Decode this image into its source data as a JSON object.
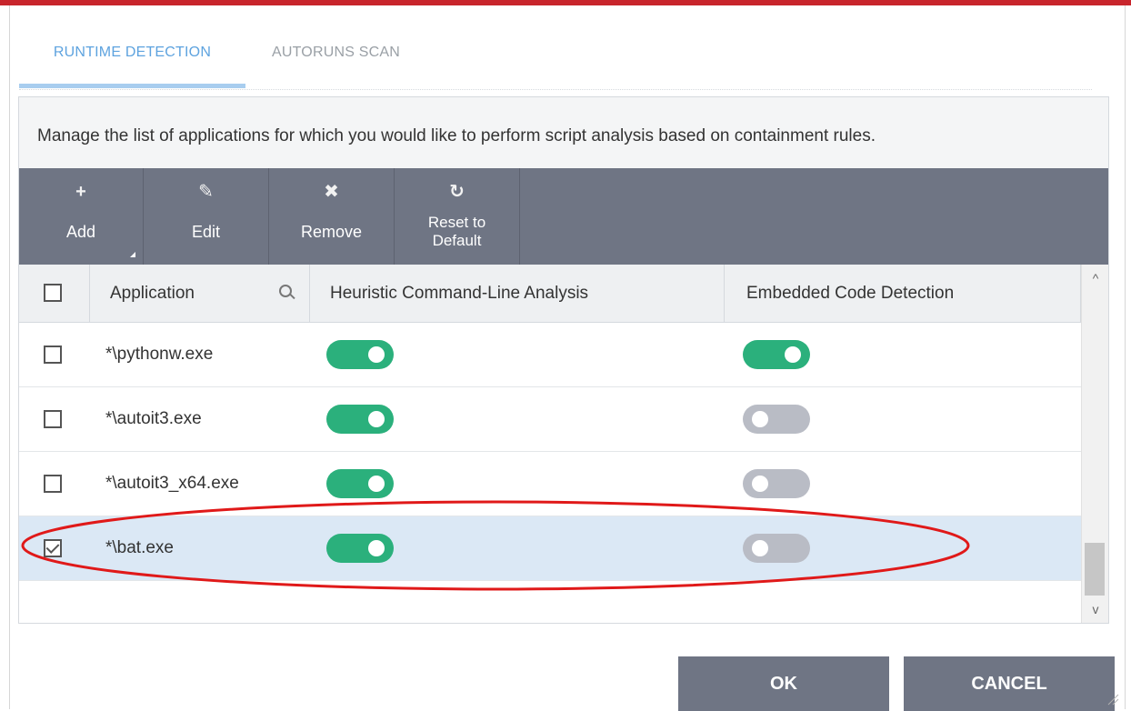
{
  "tabs": [
    {
      "label": "RUNTIME DETECTION",
      "active": true
    },
    {
      "label": "AUTORUNS SCAN",
      "active": false
    }
  ],
  "description": "Manage the list of applications for which you would like to perform script analysis based on containment rules.",
  "toolbar": {
    "add_label": "Add",
    "edit_label": "Edit",
    "remove_label": "Remove",
    "reset_label_line1": "Reset to",
    "reset_label_line2": "Default",
    "add_icon": "+",
    "edit_icon": "✎",
    "remove_icon": "✖",
    "reset_icon": "↻"
  },
  "table": {
    "headers": {
      "application": "Application",
      "heuristic": "Heuristic Command-Line Analysis",
      "embedded": "Embedded Code Detection"
    },
    "rows": [
      {
        "app": "*\\pythonw.exe",
        "checked": false,
        "heuristic": true,
        "embedded": true,
        "selected": false
      },
      {
        "app": "*\\autoit3.exe",
        "checked": false,
        "heuristic": true,
        "embedded": false,
        "selected": false
      },
      {
        "app": "*\\autoit3_x64.exe",
        "checked": false,
        "heuristic": true,
        "embedded": false,
        "selected": false
      },
      {
        "app": "*\\bat.exe",
        "checked": true,
        "heuristic": true,
        "embedded": false,
        "selected": true
      }
    ]
  },
  "scrollbar": {
    "up_icon": "^",
    "down_icon": "v"
  },
  "buttons": {
    "ok": "OK",
    "cancel": "CANCEL"
  },
  "colors": {
    "toggle_on": "#2bb07c",
    "toggle_off": "#b9bcc5",
    "toolbar_bg": "#6f7584",
    "selected_row": "#dbe8f5",
    "annotation": "#e01919",
    "active_tab": "#5ea3df"
  }
}
